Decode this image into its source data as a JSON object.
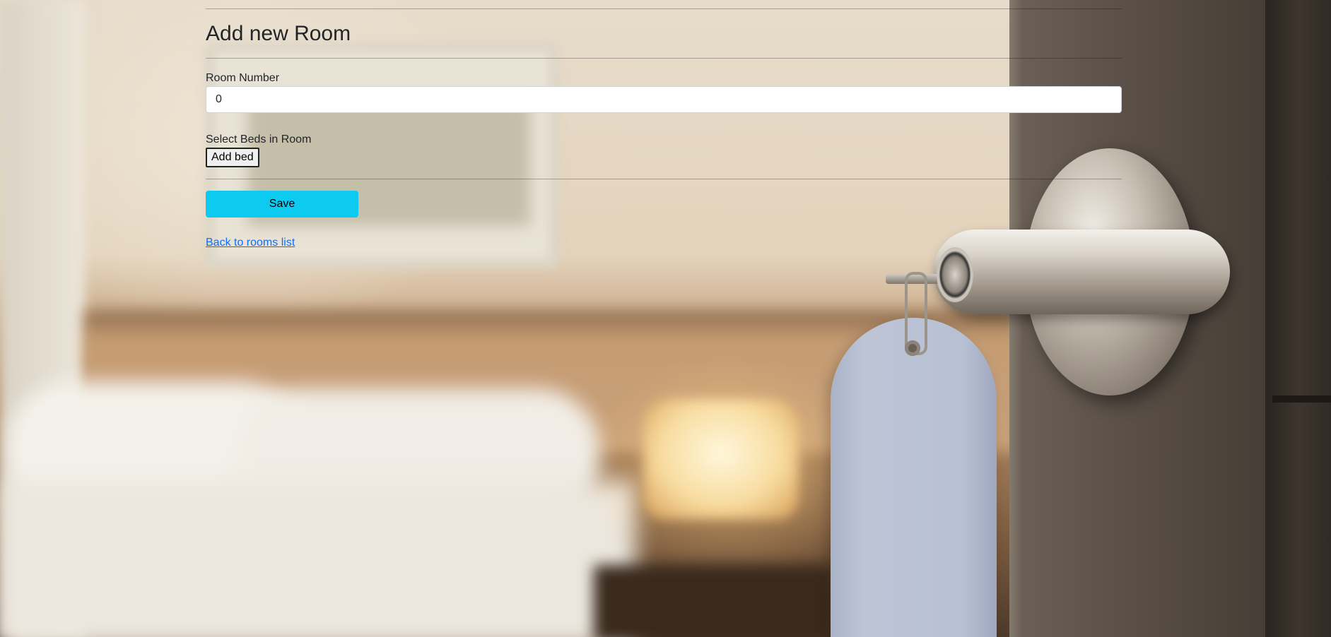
{
  "page": {
    "title": "Add new Room"
  },
  "form": {
    "room_number_label": "Room Number",
    "room_number_value": "0",
    "beds_label": "Select Beds in Room",
    "add_bed_label": "Add bed",
    "save_label": "Save",
    "back_link_label": "Back to rooms list"
  },
  "colors": {
    "save_button": "#0dcaf0",
    "link": "#0d6efd"
  }
}
